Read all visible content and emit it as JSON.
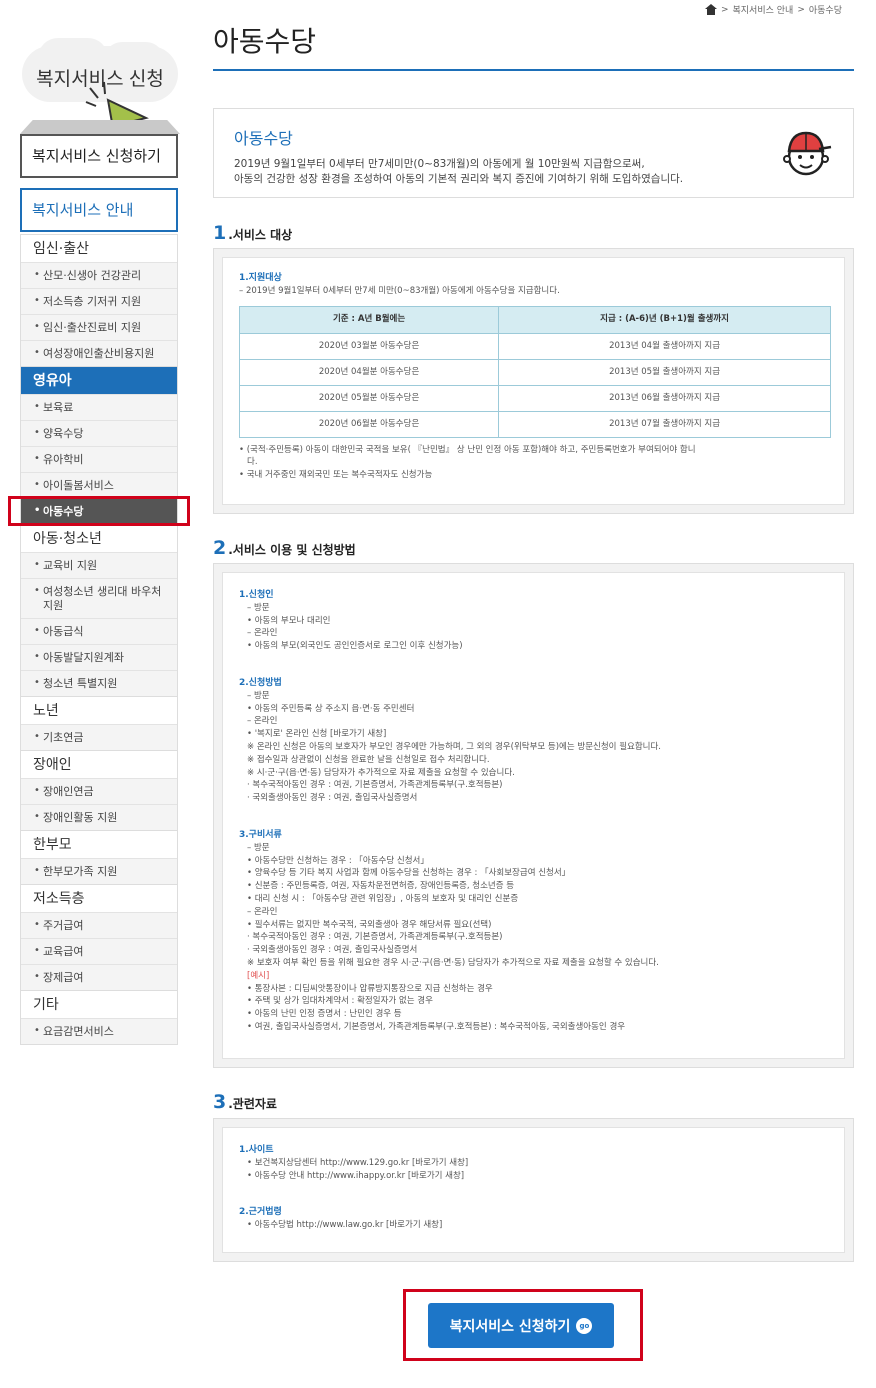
{
  "breadcrumb": {
    "items": [
      "복지서비스 안내",
      "아동수당"
    ],
    "sep": ">"
  },
  "page": {
    "title": "아동수당"
  },
  "sidebar": {
    "banner_title": "복지서비스 신청",
    "apply_button": "복지서비스 신청하기",
    "guide_header": "복지서비스 안내",
    "categories": [
      {
        "label": "임신·출산",
        "items": [
          "산모·신생아 건강관리",
          "저소득층 기저귀 지원",
          "임신·출산진료비 지원",
          "여성장애인출산비용지원"
        ]
      },
      {
        "label": "영유아",
        "items": [
          "보육료",
          "양육수당",
          "유아학비",
          "아이돌봄서비스",
          "아동수당"
        ]
      },
      {
        "label": "아동·청소년",
        "items": [
          "교육비 지원",
          "여성청소년 생리대 바우처 지원",
          "아동급식",
          "아동발달지원계좌",
          "청소년 특별지원"
        ]
      },
      {
        "label": "노년",
        "items": [
          "기초연금"
        ]
      },
      {
        "label": "장애인",
        "items": [
          "장애인연금",
          "장애인활동 지원"
        ]
      },
      {
        "label": "한부모",
        "items": [
          "한부모가족 지원"
        ]
      },
      {
        "label": "저소득층",
        "items": [
          "주거급여",
          "교육급여",
          "장제급여"
        ]
      },
      {
        "label": "기타",
        "items": [
          "요금감면서비스"
        ]
      }
    ]
  },
  "intro": {
    "title": "아동수당",
    "line1": "2019년 9월1일부터 0세부터 만7세미만(0~83개월)의 아동에게 월 10만원씩 지급함으로써,",
    "line2": "아동의 건강한 성장 환경을 조성하여 아동의 기본적 권리와 복지 증진에 기여하기 위해 도입하였습니다."
  },
  "sections": {
    "s1": {
      "num": "1",
      "title": ".서비스 대상",
      "label": "1.지원대상",
      "desc": "– 2019년 9월1일부터 0세부터 만7세 미만(0~83개월) 아동에게 아동수당을 지급합니다.",
      "table_head": [
        "기준 : A년 B월에는",
        "지급 : (A-6)년 (B+1)월 출생까지"
      ],
      "table_rows": [
        [
          "2020년 03월분 아동수당은",
          "2013년 04월 출생아까지 지급"
        ],
        [
          "2020년 04월분 아동수당은",
          "2013년 05월 출생아까지 지급"
        ],
        [
          "2020년 05월분 아동수당은",
          "2013년 06월 출생아까지 지급"
        ],
        [
          "2020년 06월분 아동수당은",
          "2013년 07월 출생아까지 지급"
        ]
      ],
      "notes": [
        "• (국적·주민등록) 아동이 대한민국 국적을 보유( 『난민법』 상 난민 인정 아동 포함)해야 하고, 주민등록번호가 부여되어야 합니",
        "  다.",
        "• 국내 거주중인 재외국민 또는 복수국적자도 신청가능"
      ]
    },
    "s2": {
      "num": "2",
      "title": ".서비스 이용 및 신청방법",
      "b1_label": "1.신청인",
      "b1_lines": [
        "– 방문",
        "• 아동의 부모나 대리인",
        "– 온라인",
        "• 아동의 부모(외국인도 공인인증서로 로그인 이후 신청가능)"
      ],
      "b2_label": "2.신청방법",
      "b2_lines": [
        "– 방문",
        "• 아동의 주민등록 상 주소지 읍·면·동 주민센터",
        "– 온라인",
        "• '복지로' 온라인 신청 [바로가기 새창]",
        "※ 온라인 신청은 아동의 보호자가 부모인 경우에만 가능하며, 그 외의 경우(위탁부모 등)에는 방문신청이 필요합니다.",
        "※ 접수일과 상관없이 신청을 완료한 날을 신청일로 접수 처리합니다.",
        "※ 시·군·구(읍·면·동) 담당자가 추가적으로 자료 제출을 요청할 수 있습니다.",
        "  · 복수국적아동인 경우 : 여권, 기본증명서, 가족관계등록부(구.호적등본)",
        "  · 국외출생아동인 경우 : 여권, 출입국사실증명서"
      ],
      "b3_label": "3.구비서류",
      "b3_lines": [
        "– 방문",
        "• 아동수당만 신청하는 경우 : 「아동수당 신청서」",
        "• 양육수당 등 기타 복지 사업과 함께 아동수당을 신청하는 경우 : 「사회보장급여 신청서」",
        "• 신분증 : 주민등록증, 여권, 자동차운전면허증, 장애인등록증, 청소년증 등",
        "• 대리 신청 시 : 「아동수당 관련 위임장」, 아동의 보호자 및 대리인 신분증",
        "– 온라인",
        "• 필수서류는 없지만 복수국적, 국외출생아 경우 해당서류 필요(선택)",
        "  · 복수국적아동인 경우 : 여권, 기본증명서, 가족관계등록부(구.호적등본)",
        "  · 국외출생아동인 경우 : 여권, 출입국사실증명서",
        "  ※ 보호자 여부 확인 등을 위해 필요한 경우 시·군·구(읍·면·동) 담당자가 추가적으로 자료 제출을 요청할 수 있습니다."
      ],
      "b3_example": "[예시]",
      "b3_example_lines": [
        "• 통장사본 : 디딤씨앗통장이나 압류방지통장으로 지급 신청하는 경우",
        "• 주택 및 상가 임대차계약서 : 확정일자가 없는 경우",
        "• 아동의 난민 인정 증명서 : 난민인 경우 등",
        "• 여권, 출입국사실증명서, 기본증명서, 가족관계등록부(구.호적등본) : 복수국적아동, 국외출생아동인 경우"
      ]
    },
    "s3": {
      "num": "3",
      "title": ".관련자료",
      "b1_label": "1.사이트",
      "b1_lines": [
        "• 보건복지상담센터 http://www.129.go.kr [바로가기 새창]",
        "• 아동수당 안내 http://www.ihappy.or.kr [바로가기 새창]"
      ],
      "b2_label": "2.근거법령",
      "b2_lines": [
        "• 아동수당법 http://www.law.go.kr [바로가기 새창]"
      ]
    }
  },
  "cta": {
    "label": "복지서비스 신청하기",
    "go": "go"
  },
  "colors": {
    "accent": "#1d6fb8",
    "button": "#1d76c8",
    "highlight": "#d0021b"
  }
}
